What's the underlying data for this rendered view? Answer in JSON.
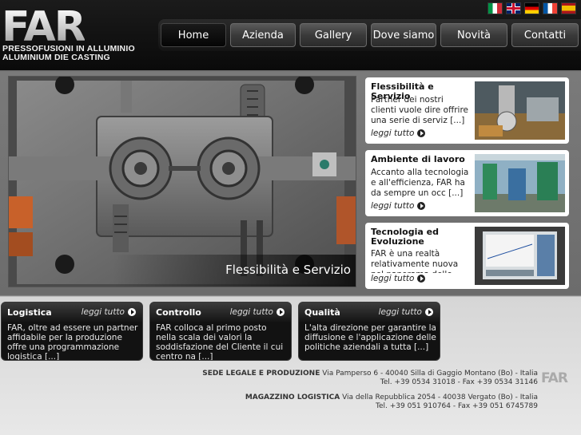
{
  "logo": {
    "word": "FAR",
    "line1": "PRESSOFUSIONI IN ALLUMINIO",
    "line2": "ALUMINIUM DIE CASTING"
  },
  "flags": [
    "italian-flag-icon",
    "english-flag-icon",
    "german-flag-icon",
    "french-flag-icon",
    "spanish-flag-icon"
  ],
  "nav": {
    "items": [
      "Home",
      "Azienda",
      "Gallery",
      "Dove siamo",
      "Novità",
      "Contatti"
    ],
    "active": "Home"
  },
  "slider": {
    "caption": "Flessibilità e Servizio"
  },
  "cards": [
    {
      "title": "Flessibilità e Servizio",
      "text": "Partner dei nostri clienti vuole dire offrire una serie di serviz [...]",
      "more": "leggi tutto"
    },
    {
      "title": "Ambiente di lavoro",
      "text": "Accanto alla tecnologia e all'efficienza, FAR ha da sempre un occ [...]",
      "more": "leggi tutto"
    },
    {
      "title": "Tecnologia ed Evoluzione",
      "text": "FAR è una realtà relativamente nuova nel panorama delle impres",
      "more": "leggi tutto"
    }
  ],
  "boxes": [
    {
      "title": "Logistica",
      "more": "leggi tutto",
      "text": "FAR, oltre ad essere un partner affidabile per la produzione offre una programmazione logistica [...]"
    },
    {
      "title": "Controllo",
      "more": "leggi tutto",
      "text": "FAR colloca al primo posto nella scala dei valori la soddisfazione del Cliente il cui centro na [...]"
    },
    {
      "title": "Qualità",
      "more": "leggi tutto",
      "text": "L'alta direzione per garantire la diffusione e l'applicazione delle politiche aziendali a tutta [...]"
    }
  ],
  "footer": {
    "sede_label": "SEDE LEGALE E PRODUZIONE",
    "sede_address": "Via Pamperso 6 - 40040 Silla di Gaggio Montano (Bo) - Italia",
    "sede_phone": "Tel. +39 0534 31018 - Fax +39 0534 31146",
    "magazzino_label": "MAGAZZINO LOGISTICA",
    "magazzino_address": "Via della Repubblica 2054 - 40038 Vergato (Bo) - Italia",
    "magazzino_phone": "Tel. +39 051 910764 - Fax +39 051 6745789",
    "logo": "FAR"
  },
  "colors": {
    "accent": "#ffffff",
    "nav_bg": "#141414",
    "box_bg": "#121212"
  }
}
